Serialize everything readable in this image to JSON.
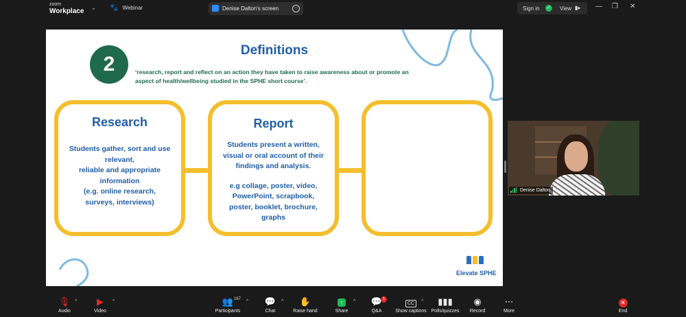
{
  "app": {
    "brand_small": "zoom",
    "brand_large": "Workplace",
    "webinar_label": "Webinar"
  },
  "share_tab": {
    "label": "Denise Dalton's screen"
  },
  "titlebar": {
    "signin": "Sign in",
    "view": "View"
  },
  "slide": {
    "number": "2",
    "title": "Definitions",
    "quote_line1": "‘research, report and reflect on an action they have taken to raise awareness about or promote an",
    "quote_line2": "aspect of health/wellbeing studied in the SPHE short course’.",
    "cards": [
      {
        "title": "Research",
        "lines": [
          "Students gather, sort and use",
          "relevant,",
          "reliable and appropriate",
          "information",
          "(e.g. online research,",
          "surveys, interviews)"
        ]
      },
      {
        "title": "Report",
        "lines": [
          "Students present a written,",
          "visual or oral account of their",
          "findings and analysis."
        ],
        "lines2": [
          "e.g collage, poster, video,",
          "PowerPoint, scrapbook,",
          "poster, booklet, brochure,",
          "graphs"
        ]
      },
      {
        "title": "",
        "lines": []
      }
    ],
    "logo_text": "Elevate SPHE"
  },
  "video": {
    "participant_name": "Denise Dalton"
  },
  "toolbar": {
    "audio": "Audio",
    "video": "Video",
    "participants": "Participants",
    "participants_count": "167",
    "chat": "Chat",
    "raise_hand": "Raise hand",
    "share": "Share",
    "qa": "Q&A",
    "qa_badge": "1",
    "show_captions": "Show captions",
    "polls": "Polls/quizzes",
    "record": "Record",
    "more": "More",
    "end": "End"
  },
  "colors": {
    "accent_blue": "#1f5ea8",
    "accent_green": "#1d6b4e",
    "card_border": "#f4be2c",
    "squiggle": "#7fb8e0",
    "share_green": "#1db954",
    "end_red": "#e02828"
  }
}
